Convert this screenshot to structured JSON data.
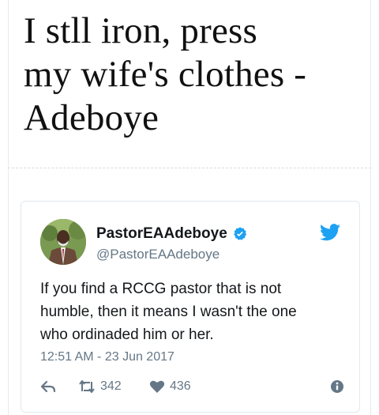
{
  "headline": {
    "line1": "I stll iron, press",
    "line2": "my wife's clothes -",
    "line3": "Adeboye"
  },
  "tweet": {
    "display_name": "PastorEAAdeboye",
    "handle": "@PastorEAAdeboye",
    "text_lines": [
      "If you find a RCCG pastor that is not",
      "humble, then it means I wasn't the one",
      "who ordinaded him or her."
    ],
    "timestamp": "12:51 AM - 23 Jun 2017",
    "retweet_count": "342",
    "like_count": "436"
  },
  "icons": {
    "avatar": "avatar-photo",
    "verified": "verified-badge-icon",
    "brand": "twitter-bird-icon",
    "reply": "reply-icon",
    "retweet": "retweet-icon",
    "like": "heart-icon",
    "info": "info-icon"
  },
  "colors": {
    "twitter_blue": "#1da1f2",
    "text_primary": "#14171a",
    "text_secondary": "#657786",
    "border": "#e1e8ed"
  }
}
